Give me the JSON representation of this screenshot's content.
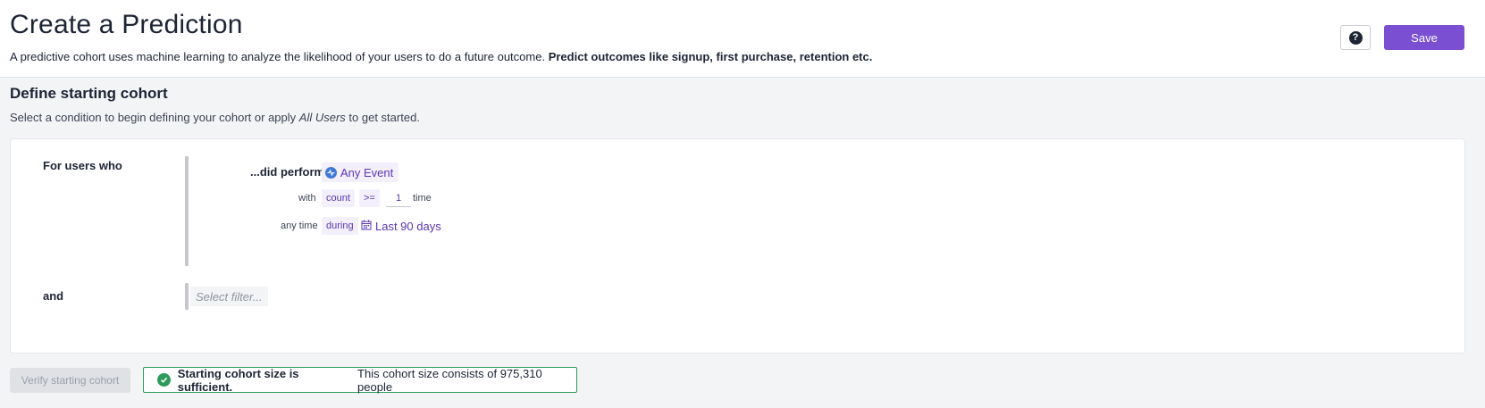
{
  "header": {
    "title": "Create a Prediction",
    "subtitle_plain": "A predictive cohort uses machine learning to analyze the likelihood of your users to do a future outcome.",
    "subtitle_bold": "Predict outcomes like signup, first purchase, retention etc.",
    "help_label": "?",
    "save_label": "Save"
  },
  "section": {
    "title": "Define starting cohort",
    "desc_before": "Select a condition to begin defining your cohort or apply",
    "desc_italic": "All Users",
    "desc_after": "to get started."
  },
  "cohort": {
    "row1_label": "For users who",
    "perform_label": "...did perform",
    "event_label": "Any Event",
    "event_icon": "event-icon",
    "with_label": "with",
    "metric_label": "count",
    "operator_label": ">=",
    "count_value": "1",
    "unit_label": "time",
    "anytime_label": "any time",
    "during_label": "during",
    "date_icon": "calendar-icon",
    "date_range": "Last 90 days",
    "row2_label": "and",
    "filter_placeholder": "Select filter..."
  },
  "footer": {
    "verify_label": "Verify starting cohort",
    "status_strong": "Starting cohort size is sufficient.",
    "status_text": "This cohort size consists of 975,310 people"
  },
  "colors": {
    "accent": "#7a4fd1",
    "success": "#2e9b5c",
    "event_icon": "#3f79d6"
  }
}
